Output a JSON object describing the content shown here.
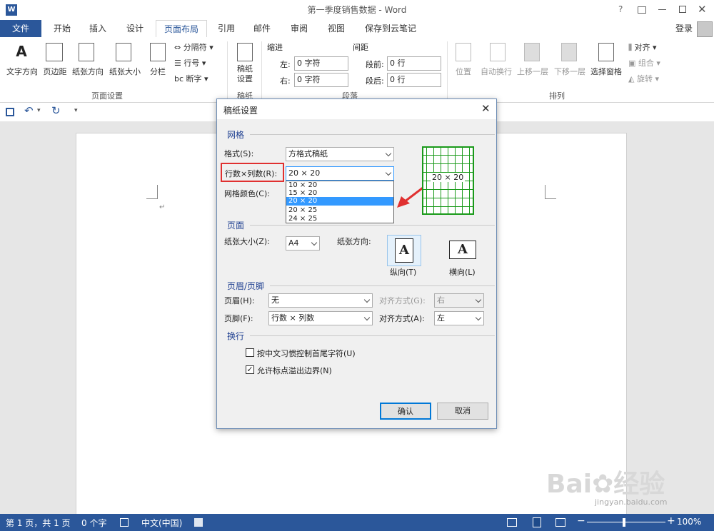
{
  "window": {
    "title": "第一季度销售数据 - Word",
    "word_icon": "W",
    "signin": "登录"
  },
  "tabs": [
    {
      "label": "文件"
    },
    {
      "label": "开始"
    },
    {
      "label": "插入"
    },
    {
      "label": "设计"
    },
    {
      "label": "页面布局"
    },
    {
      "label": "引用"
    },
    {
      "label": "邮件"
    },
    {
      "label": "审阅"
    },
    {
      "label": "视图"
    },
    {
      "label": "保存到云笔记"
    }
  ],
  "ribbon": {
    "page_setup": {
      "text_direction": "文字方向",
      "margins": "页边距",
      "orientation": "纸张方向",
      "size": "纸张大小",
      "columns": "分栏",
      "breaks": "分隔符",
      "line_numbers": "行号",
      "hyphenation": "断字",
      "group": "页面设置"
    },
    "manuscript": {
      "button": "稿纸\n设置",
      "group": "稿纸"
    },
    "paragraph": {
      "indent": "缩进",
      "spacing": "间距",
      "left": "左:",
      "right": "右:",
      "before": "段前:",
      "after": "段后:",
      "left_val": "0 字符",
      "right_val": "0 字符",
      "before_val": "0 行",
      "after_val": "0 行",
      "group": "段落"
    },
    "arrange": {
      "position": "位置",
      "wrap": "自动换行",
      "forward": "上移一层",
      "backward": "下移一层",
      "selection": "选择窗格",
      "align": "对齐",
      "group_btn": "组合",
      "rotate": "旋转",
      "group": "排列"
    }
  },
  "dialog": {
    "title": "稿纸设置",
    "grid_section": "网格",
    "style_label": "格式(S):",
    "style_value": "方格式稿纸",
    "rowcol_label": "行数×列数(R):",
    "rowcol_value": "20 × 20",
    "color_label": "网格颜色(C):",
    "rowcol_options": [
      "10 × 20",
      "15 × 20",
      "20 × 20",
      "20 × 25",
      "24 × 25"
    ],
    "selected_option": 2,
    "preview_label": "20 × 20",
    "page_section": "页面",
    "size_label": "纸张大小(Z):",
    "size_value": "A4",
    "orient_label": "纸张方向:",
    "portrait": "纵向(T)",
    "landscape": "横向(L)",
    "orient_glyph": "A",
    "hf_section": "页眉/页脚",
    "header_label": "页眉(H):",
    "header_value": "无",
    "header_align_label": "对齐方式(G):",
    "header_align_value": "右",
    "footer_label": "页脚(F):",
    "footer_value": "行数 × 列数",
    "footer_align_label": "对齐方式(A):",
    "footer_align_value": "左",
    "wrap_section": "换行",
    "chk1": "按中文习惯控制首尾字符(U)",
    "chk1_checked": false,
    "chk2": "允许标点溢出边界(N)",
    "chk2_checked": true,
    "ok": "确认",
    "cancel": "取消"
  },
  "status": {
    "page": "第 1 页，共 1 页",
    "words": "0 个字",
    "lang": "中文(中国)",
    "zoom": "100%"
  },
  "watermark": {
    "brand": "Bai",
    "brand2": "经验",
    "url": "jingyan.baidu.com"
  },
  "colors": {
    "accent": "#2b579a",
    "highlight_red": "#e03030",
    "grid_green": "#1a9a1a",
    "selected_blue": "#3399ff"
  }
}
